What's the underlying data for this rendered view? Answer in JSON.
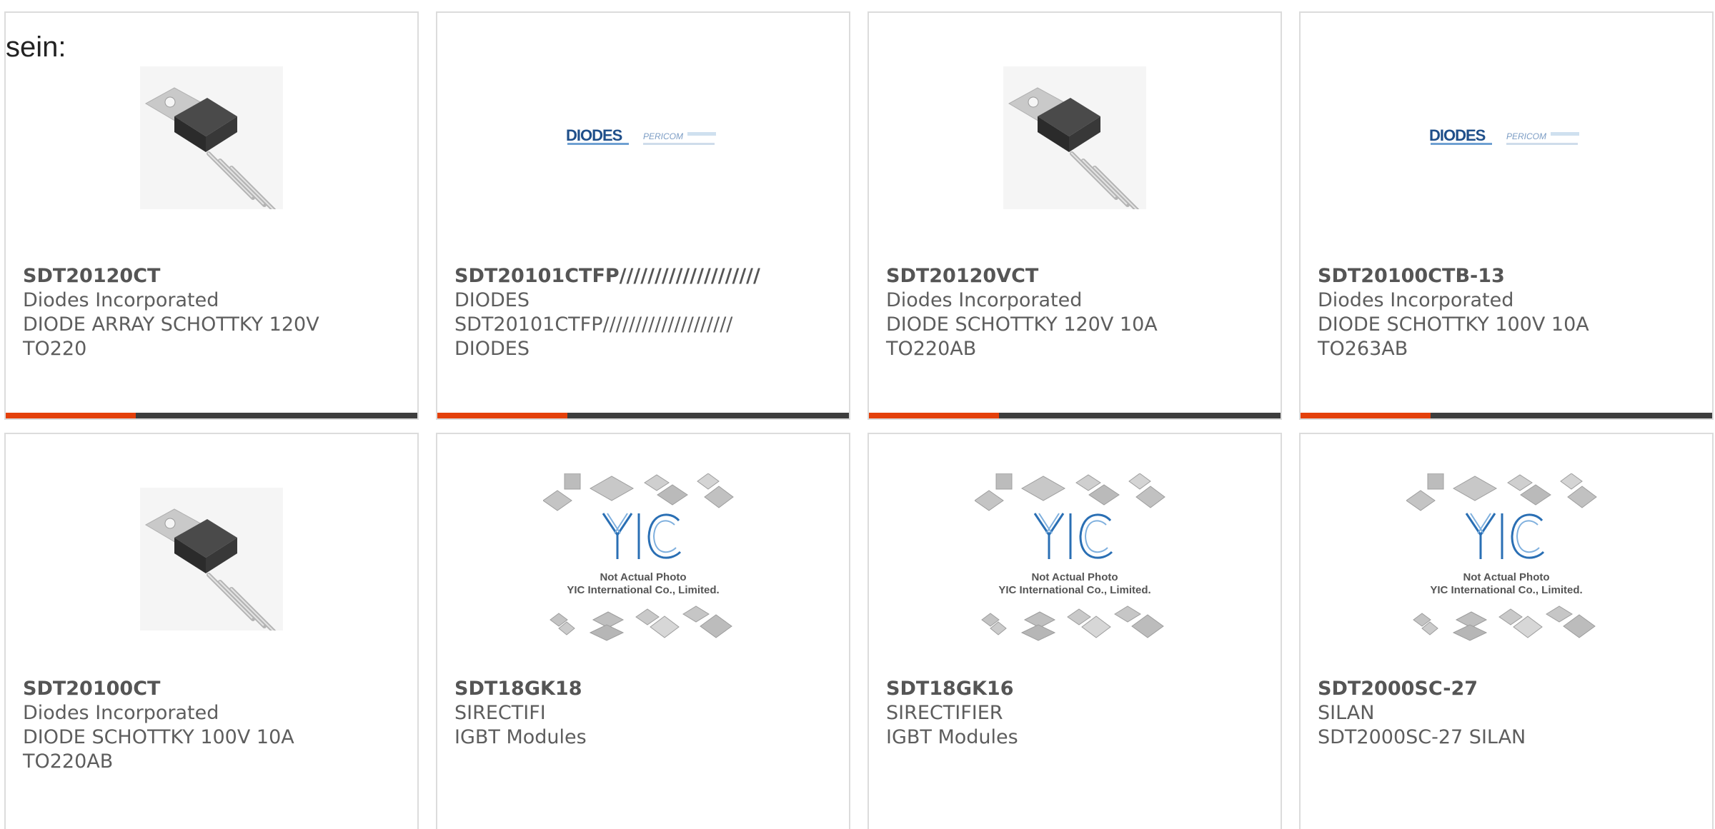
{
  "intro_text": "sein:",
  "colors": {
    "accent": "#e4400b",
    "bar": "#3d3d3d",
    "border": "#dcdcdc",
    "text": "#5d5d5d"
  },
  "products": [
    {
      "part": "SDT20120CT",
      "lines": [
        "Diodes Incorporated",
        "DIODE ARRAY SCHOTTKY 120V",
        "TO220"
      ],
      "image": "to220-package-icon"
    },
    {
      "part": "SDT20101CTFP////////////////////",
      "lines": [
        "DIODES",
        "SDT20101CTFP////////////////////",
        "DIODES"
      ],
      "image": "diodes-pericom-logo",
      "logo_text": "DIODES",
      "logo_sub": "PERICOM"
    },
    {
      "part": "SDT20120VCT",
      "lines": [
        "Diodes Incorporated",
        "DIODE SCHOTTKY 120V 10A",
        "TO220AB"
      ],
      "image": "to220-package-icon"
    },
    {
      "part": "SDT20100CTB-13",
      "lines": [
        "Diodes Incorporated",
        "DIODE SCHOTTKY 100V 10A",
        "TO263AB"
      ],
      "image": "diodes-pericom-logo",
      "logo_text": "DIODES",
      "logo_sub": "PERICOM"
    },
    {
      "part": "SDT20100CT",
      "lines": [
        "Diodes Incorporated",
        "DIODE SCHOTTKY 100V 10A",
        "TO220AB"
      ],
      "image": "to220-package-icon"
    },
    {
      "part": "SDT18GK18",
      "lines": [
        "SIRECTIFI",
        "IGBT Modules"
      ],
      "image": "yic-placeholder",
      "yic_logo": "YIC",
      "yic_line1": "Not Actual Photo",
      "yic_line2": "YIC International Co., Limited."
    },
    {
      "part": "SDT18GK16",
      "lines": [
        "SIRECTIFIER",
        "IGBT Modules"
      ],
      "image": "yic-placeholder",
      "yic_logo": "YIC",
      "yic_line1": "Not Actual Photo",
      "yic_line2": "YIC International Co., Limited."
    },
    {
      "part": "SDT2000SC-27",
      "lines": [
        "SILAN",
        "SDT2000SC-27 SILAN"
      ],
      "image": "yic-placeholder",
      "yic_logo": "YIC",
      "yic_line1": "Not Actual Photo",
      "yic_line2": "YIC International Co., Limited."
    }
  ]
}
